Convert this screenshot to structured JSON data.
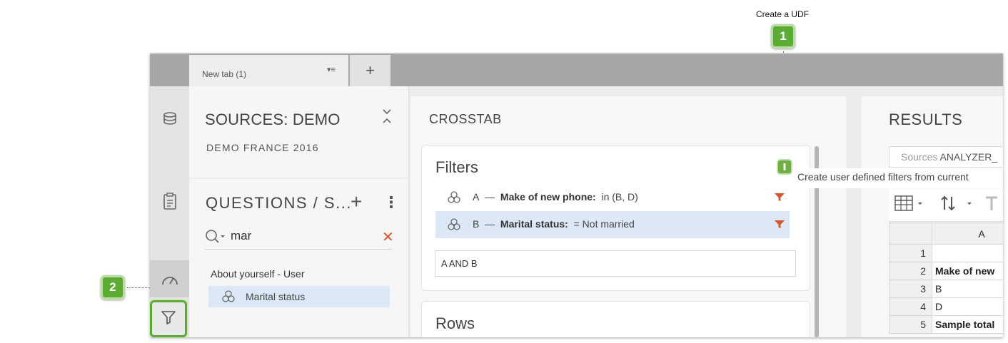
{
  "callouts": {
    "udf_title": "Create a UDF",
    "badge_1": "1",
    "badge_2": "2"
  },
  "tabbar": {
    "tab_label": "New tab (1)",
    "tab_menu": "▾≡",
    "add_tab": "+"
  },
  "sources": {
    "title": "SOURCES: DEMO",
    "subtitle": "DEMO FRANCE 2016"
  },
  "questions": {
    "title": "QUESTIONS / S...",
    "add": "+",
    "more": "⋮",
    "search_value": "mar",
    "clear": "✕",
    "group_label": "About yourself - User",
    "item_label": "Marital status"
  },
  "crosstab": {
    "title": "CROSSTAB",
    "filters_title": "Filters",
    "filters": [
      {
        "letter": "A",
        "dash": "—",
        "name": "Make of new phone:",
        "condition": "in (B, D)"
      },
      {
        "letter": "B",
        "dash": "—",
        "name": "Marital status:",
        "condition": "= Not married"
      }
    ],
    "expression": "A AND B",
    "rows_title": "Rows"
  },
  "tooltip": "Create user defined filters from current",
  "results": {
    "title": "RESULTS",
    "sources_label": "Sources",
    "sources_value": "ANALYZER_",
    "column_header": "A",
    "rows": [
      {
        "n": "1",
        "value": ""
      },
      {
        "n": "2",
        "value": "Make of new"
      },
      {
        "n": "3",
        "value": "B"
      },
      {
        "n": "4",
        "value": "D"
      },
      {
        "n": "5",
        "value": "Sample total"
      }
    ]
  },
  "colors": {
    "accent_green": "#5bab34",
    "filter_funnel": "#d4582d",
    "selection": "#dde8f6"
  }
}
